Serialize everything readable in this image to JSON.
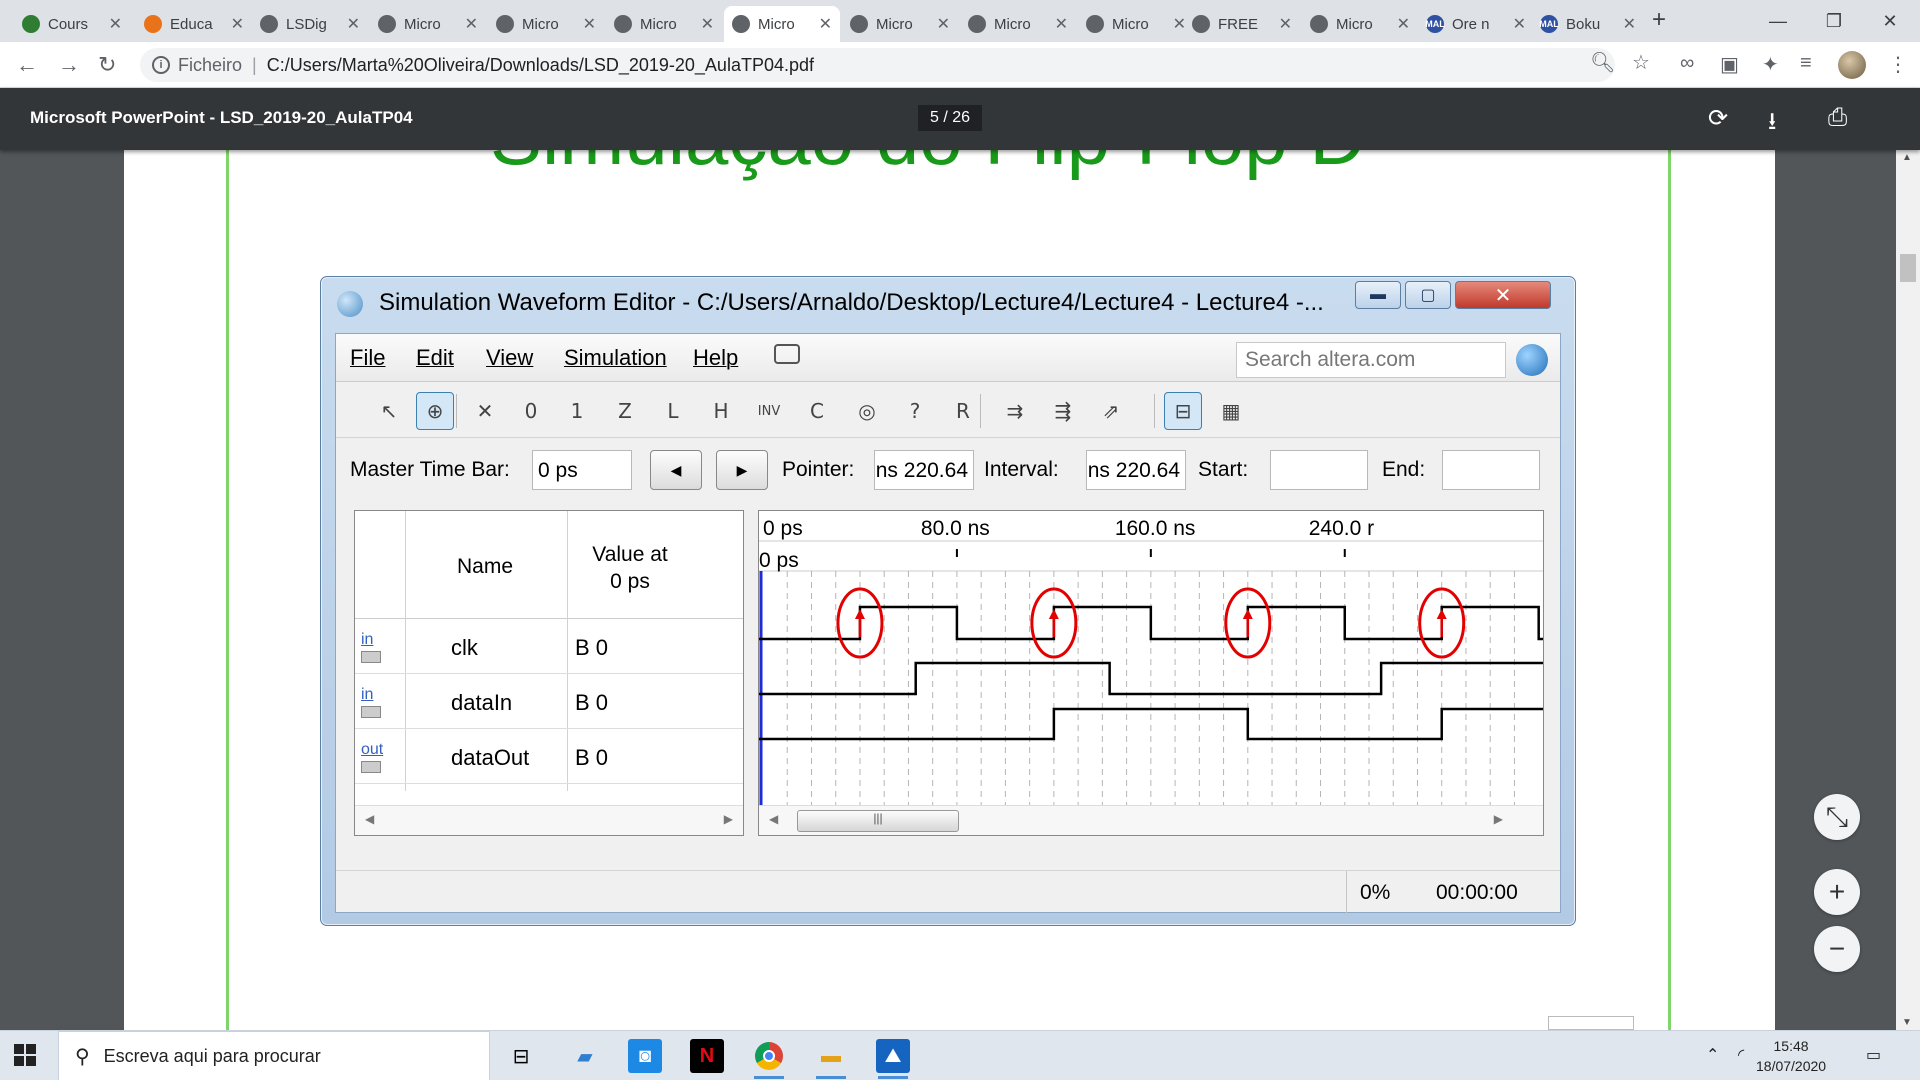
{
  "browser": {
    "tabs": [
      {
        "title": "Cours",
        "fav_color": "#2e7d32",
        "fav_text": ""
      },
      {
        "title": "Educa",
        "fav_color": "#e8731a",
        "fav_text": ""
      },
      {
        "title": "LSDig",
        "fav_color": "#5f6368",
        "fav_text": ""
      },
      {
        "title": "Micro",
        "fav_color": "#5f6368",
        "fav_text": ""
      },
      {
        "title": "Micro",
        "fav_color": "#5f6368",
        "fav_text": ""
      },
      {
        "title": "Micro",
        "fav_color": "#5f6368",
        "fav_text": ""
      },
      {
        "title": "Micro",
        "fav_color": "#5f6368",
        "fav_text": "",
        "active": true
      },
      {
        "title": "Micro",
        "fav_color": "#5f6368",
        "fav_text": ""
      },
      {
        "title": "Micro",
        "fav_color": "#5f6368",
        "fav_text": ""
      },
      {
        "title": "Micro",
        "fav_color": "#5f6368",
        "fav_text": ""
      },
      {
        "title": "FREE",
        "fav_color": "#5f6368",
        "fav_text": ""
      },
      {
        "title": "Micro",
        "fav_color": "#5f6368",
        "fav_text": ""
      },
      {
        "title": "Ore n",
        "fav_color": "#2e51a2",
        "fav_text": "MAL"
      },
      {
        "title": "Boku",
        "fav_color": "#2e51a2",
        "fav_text": "MAL"
      }
    ],
    "url_scheme": "Ficheiro",
    "url": "C:/Users/Marta%20Oliveira/Downloads/LSD_2019-20_AulaTP04.pdf"
  },
  "pdf": {
    "title": "Microsoft PowerPoint - LSD_2019-20_AulaTP04",
    "page_indicator": "5 / 26",
    "slide_title": "Simulação do Flip-Flop D"
  },
  "quartus": {
    "window_title": "Simulation Waveform Editor - C:/Users/Arnaldo/Desktop/Lecture4/Lecture4 - Lecture4 -...",
    "menu": [
      "File",
      "Edit",
      "View",
      "Simulation",
      "Help"
    ],
    "search_placeholder": "Search altera.com",
    "tools": [
      {
        "glyph": "↖",
        "name": "select-tool-icon"
      },
      {
        "glyph": "⊕",
        "name": "zoom-tool-icon",
        "on": true
      },
      {
        "glyph": "✕",
        "name": "forcing-unknown-icon"
      },
      {
        "glyph": "0",
        "name": "forcing-low-icon"
      },
      {
        "glyph": "1",
        "name": "forcing-high-icon"
      },
      {
        "glyph": "Z",
        "name": "high-impedance-icon"
      },
      {
        "glyph": "L",
        "name": "weak-low-icon"
      },
      {
        "glyph": "H",
        "name": "weak-high-icon"
      },
      {
        "glyph": "INV",
        "name": "invert-icon"
      },
      {
        "glyph": "C",
        "name": "count-value-icon"
      },
      {
        "glyph": "◎",
        "name": "overwrite-clock-icon"
      },
      {
        "glyph": "?",
        "name": "random-values-icon"
      },
      {
        "glyph": "R",
        "name": "arbitrary-value-icon"
      },
      {
        "glyph": "⇉",
        "name": "functional-simulation-icon"
      },
      {
        "glyph": "⇶",
        "name": "timing-simulation-icon"
      },
      {
        "glyph": "⇗",
        "name": "generate-netlist-icon"
      },
      {
        "glyph": "⊟",
        "name": "snap-to-grid-icon",
        "on": true
      },
      {
        "glyph": "▦",
        "name": "grid-settings-icon"
      }
    ],
    "time_bar": {
      "master_label": "Master Time Bar:",
      "master_value": "0 ps",
      "pointer_label": "Pointer:",
      "pointer_value": "220.64 ns",
      "interval_label": "Interval:",
      "interval_value": "220.64 ns",
      "start_label": "Start:",
      "start_value": "",
      "end_label": "End:",
      "end_value": ""
    },
    "node_header": {
      "name": "Name",
      "value_line1": "Value at",
      "value_line2": "0 ps"
    },
    "signals": [
      {
        "dir": "in",
        "name": "clk",
        "value": "B 0"
      },
      {
        "dir": "in",
        "name": "dataIn",
        "value": "B 0"
      },
      {
        "dir": "out",
        "name": "dataOut",
        "value": "B 0"
      }
    ],
    "timeline": {
      "ticks": [
        "0 ps",
        "80.0 ns",
        "160.0 ns",
        "240.0 r"
      ],
      "cursor_label": "0 ps"
    },
    "status": {
      "percent": "0%",
      "elapsed": "00:00:00"
    }
  },
  "waveform_data": {
    "x_unit": "ns",
    "clk_rising_edges": [
      40,
      120,
      200,
      280,
      360
    ],
    "clk_falling_edges": [
      80,
      160,
      240,
      320
    ],
    "dataIn_high": [
      [
        63,
        143
      ],
      [
        255,
        335
      ]
    ],
    "dataOut_high": [
      [
        120,
        200
      ],
      [
        280,
        360
      ]
    ],
    "highlighted_edges": [
      40,
      120,
      200,
      280,
      360
    ]
  },
  "taskbar": {
    "search_placeholder": "Escreva aqui para procurar",
    "time": "15:48",
    "date": "18/07/2020"
  },
  "colors": {
    "slide_title": "#1a9a1a",
    "slide_border": "#7fd46a",
    "edge_marker": "#e30000",
    "cursor": "#1f2bd8"
  }
}
